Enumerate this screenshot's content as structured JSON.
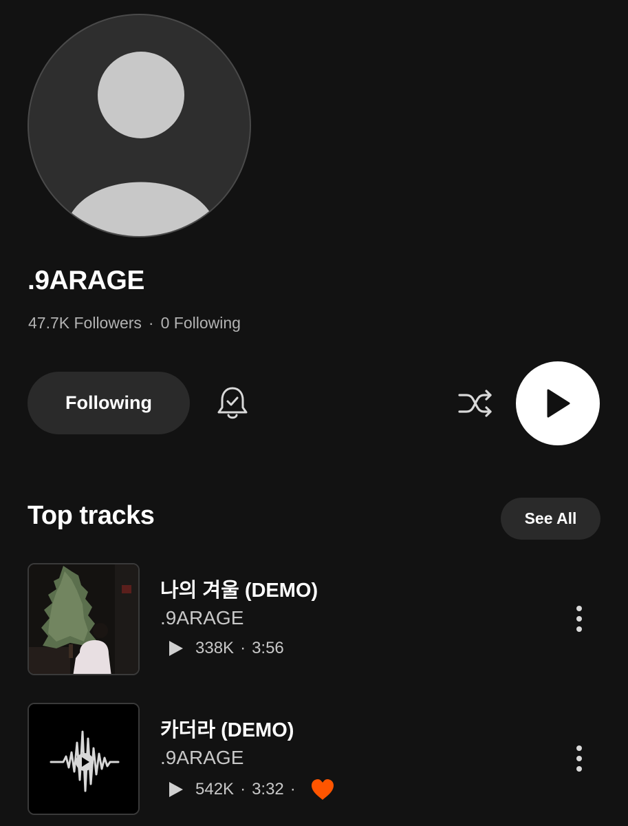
{
  "artist": {
    "name": ".9ARAGE",
    "followers": "47.7K Followers",
    "separator": "·",
    "following": "0 Following"
  },
  "actions": {
    "following_label": "Following",
    "bell_icon": "bell-check-icon",
    "shuffle_icon": "shuffle-icon",
    "play_icon": "play-icon"
  },
  "top_tracks": {
    "title": "Top tracks",
    "see_all_label": "See All",
    "items": [
      {
        "title": "나의 겨울 (DEMO)",
        "artist": ".9ARAGE",
        "plays": "338K",
        "separator": "·",
        "duration": "3:56",
        "liked": false
      },
      {
        "title": "카더라 (DEMO)",
        "artist": ".9ARAGE",
        "plays": "542K",
        "separator": "·",
        "duration": "3:32",
        "liked": true
      }
    ]
  },
  "colors": {
    "background": "#121212",
    "surface": "#2a2a2a",
    "text_primary": "#ffffff",
    "text_secondary": "#b3b3b3",
    "like_accent": "#ff5500"
  }
}
